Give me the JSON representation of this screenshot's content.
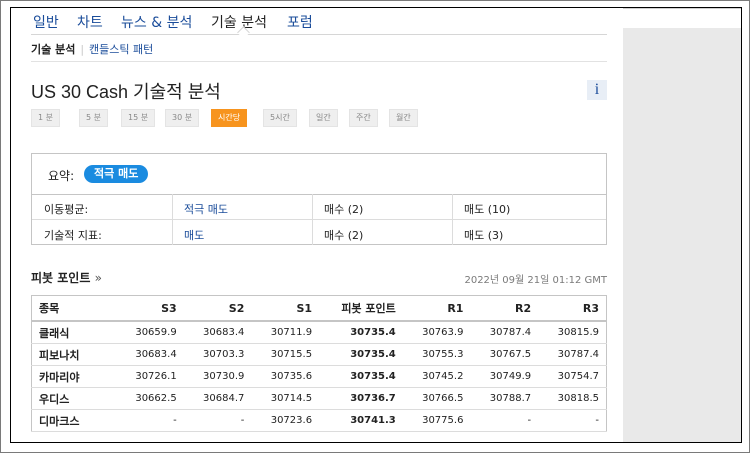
{
  "nav": {
    "items": [
      "일반",
      "차트",
      "뉴스 & 분석",
      "기술 분석",
      "포럼"
    ],
    "active": "기술 분석"
  },
  "subnav": {
    "active": "기술 분석",
    "other": "캔들스틱 패턴"
  },
  "page_title": "US 30 Cash 기술적 분석",
  "info_icon": "i",
  "timeframes": {
    "items": [
      "1 분",
      "5 분",
      "15 분",
      "30 분",
      "시간당",
      "5시간",
      "일간",
      "주간",
      "월간"
    ],
    "active": "시간당"
  },
  "summary": {
    "label": "요약:",
    "badge": "적극 매도",
    "badge_color": "#1a8be0",
    "rows": [
      {
        "label": "이동평균:",
        "signal": "적극 매도",
        "buy": "매수 (2)",
        "sell": "매도 (10)"
      },
      {
        "label": "기술적 지표:",
        "signal": "매도",
        "buy": "매수 (2)",
        "sell": "매도 (3)"
      }
    ]
  },
  "pivot": {
    "heading": "피봇 포인트",
    "arrow": "»",
    "timestamp": "2022년 09월 21일 01:12 GMT",
    "columns": [
      "종목",
      "S3",
      "S2",
      "S1",
      "피봇 포인트",
      "R1",
      "R2",
      "R3"
    ],
    "rows": [
      [
        "클래식",
        "30659.9",
        "30683.4",
        "30711.9",
        "30735.4",
        "30763.9",
        "30787.4",
        "30815.9"
      ],
      [
        "피보나치",
        "30683.4",
        "30703.3",
        "30715.5",
        "30735.4",
        "30755.3",
        "30767.5",
        "30787.4"
      ],
      [
        "카마리야",
        "30726.1",
        "30730.9",
        "30735.6",
        "30735.4",
        "30745.2",
        "30749.9",
        "30754.7"
      ],
      [
        "우디스",
        "30662.5",
        "30684.7",
        "30714.5",
        "30736.7",
        "30766.5",
        "30788.7",
        "30818.5"
      ],
      [
        "디마크스",
        "-",
        "-",
        "30723.6",
        "30741.3",
        "30775.6",
        "-",
        "-"
      ]
    ]
  },
  "colors": {
    "accent": "#f7941e",
    "link": "#1a4c9a"
  }
}
